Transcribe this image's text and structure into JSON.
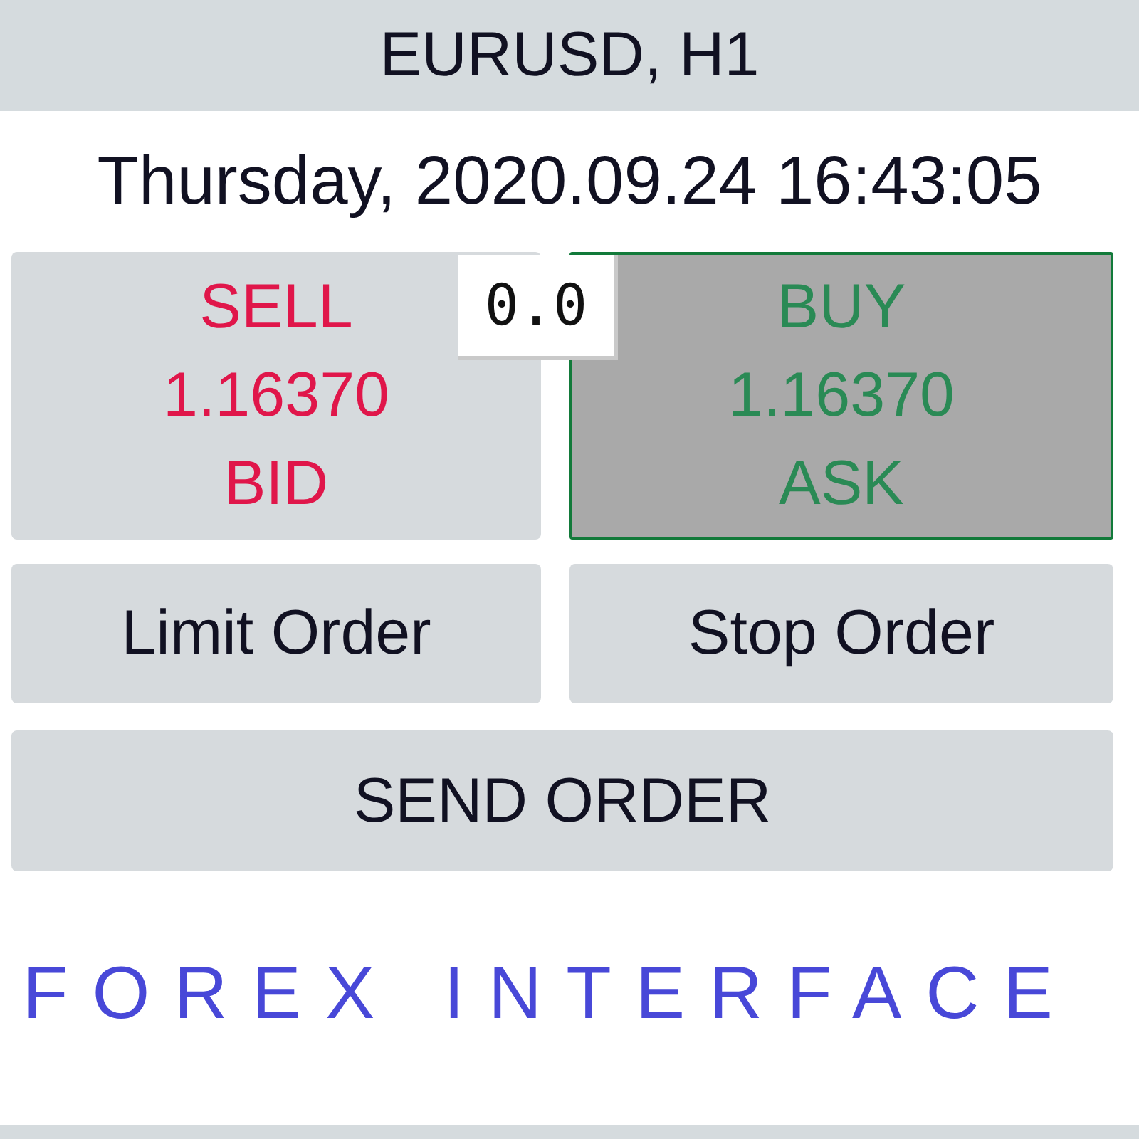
{
  "title_bar": {
    "title": "EURUSD, H1"
  },
  "datetime": "Thursday, 2020.09.24 16:43:05",
  "quote_buttons": [
    {
      "kind": "sell",
      "label": "SELL",
      "price": "1.16370",
      "price_type": "BID",
      "selected": false
    },
    {
      "kind": "buy",
      "label": "BUY",
      "price": "1.16370",
      "price_type": "ASK",
      "selected": true
    }
  ],
  "spread": "0.0",
  "order_buttons": [
    {
      "label": "Limit Order"
    },
    {
      "label": "Stop Order"
    }
  ],
  "send_button": {
    "label": "SEND ORDER"
  },
  "footer_title": "FOREX INTERFACE"
}
